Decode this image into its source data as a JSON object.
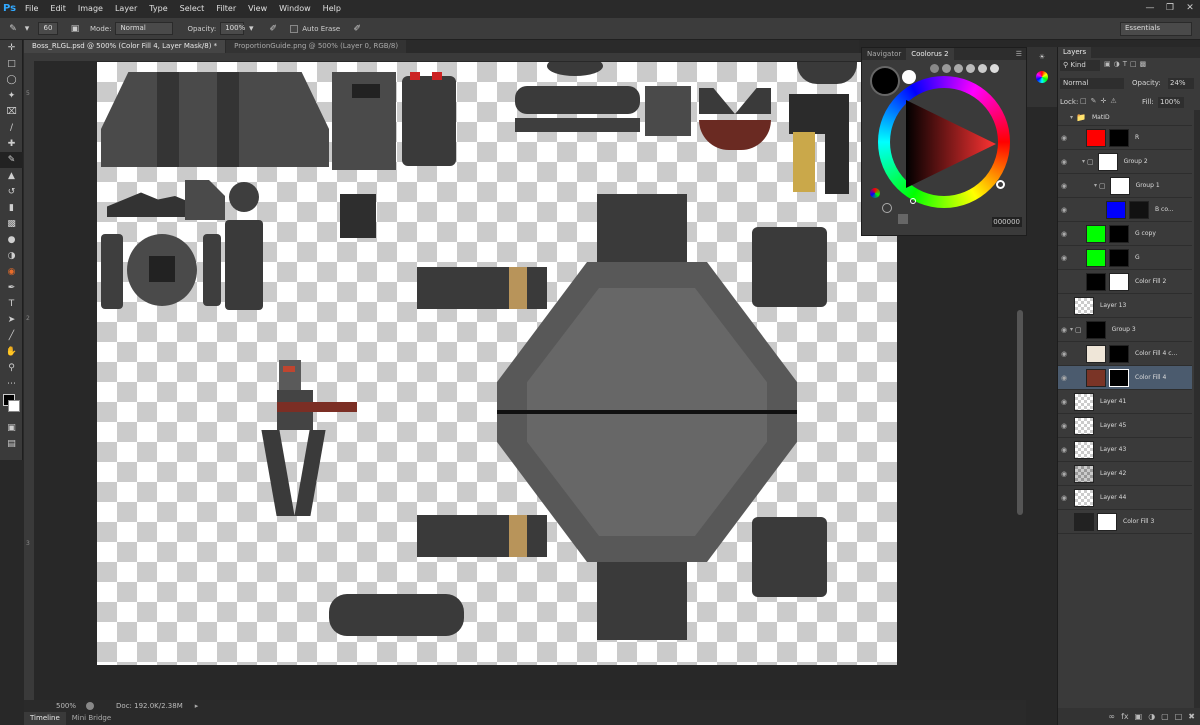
{
  "app": {
    "logo": "Ps"
  },
  "menu": [
    "File",
    "Edit",
    "Image",
    "Layer",
    "Type",
    "Select",
    "Filter",
    "View",
    "Window",
    "Help"
  ],
  "options": {
    "brush_size": "60",
    "mode_label": "Mode:",
    "mode_value": "Normal",
    "opacity_label": "Opacity:",
    "opacity_value": "100%",
    "auto_erase_label": "Auto Erase",
    "workspace": "Essentials"
  },
  "tabs": [
    {
      "label": "Boss_RLGL.psd @ 500% (Color Fill 4, Layer Mask/8) *"
    },
    {
      "label": "ProportionGuide.png @ 500% (Layer 0, RGB/8)"
    }
  ],
  "status": {
    "zoom": "500%",
    "doc": "Doc: 192.0K/2.38M"
  },
  "bottom_tabs": [
    "Timeline",
    "Mini Bridge"
  ],
  "color_panel": {
    "tabs": [
      "Navigator",
      "Coolorus 2"
    ],
    "hex": "000000"
  },
  "layers": {
    "title": "Layers",
    "filter": "Kind",
    "blend_mode": "Normal",
    "opacity_label": "Opacity:",
    "opacity_value": "24%",
    "lock_label": "Lock:",
    "fill_label": "Fill:",
    "fill_value": "100%",
    "rows": [
      {
        "name": "MatID"
      },
      {
        "name": "R"
      },
      {
        "name": "Group 2"
      },
      {
        "name": "Group 1"
      },
      {
        "name": "B co..."
      },
      {
        "name": "G copy"
      },
      {
        "name": "G"
      },
      {
        "name": "Color Fill 2"
      },
      {
        "name": "Layer 13"
      },
      {
        "name": "Group 3"
      },
      {
        "name": "Color Fill 4 c..."
      },
      {
        "name": "Color Fill 4"
      },
      {
        "name": "Layer 41"
      },
      {
        "name": "Layer 45"
      },
      {
        "name": "Layer 43"
      },
      {
        "name": "Layer 42"
      },
      {
        "name": "Layer 44"
      },
      {
        "name": "Color Fill 3"
      }
    ]
  },
  "ruler_marks": [
    "5",
    "2",
    "3"
  ]
}
